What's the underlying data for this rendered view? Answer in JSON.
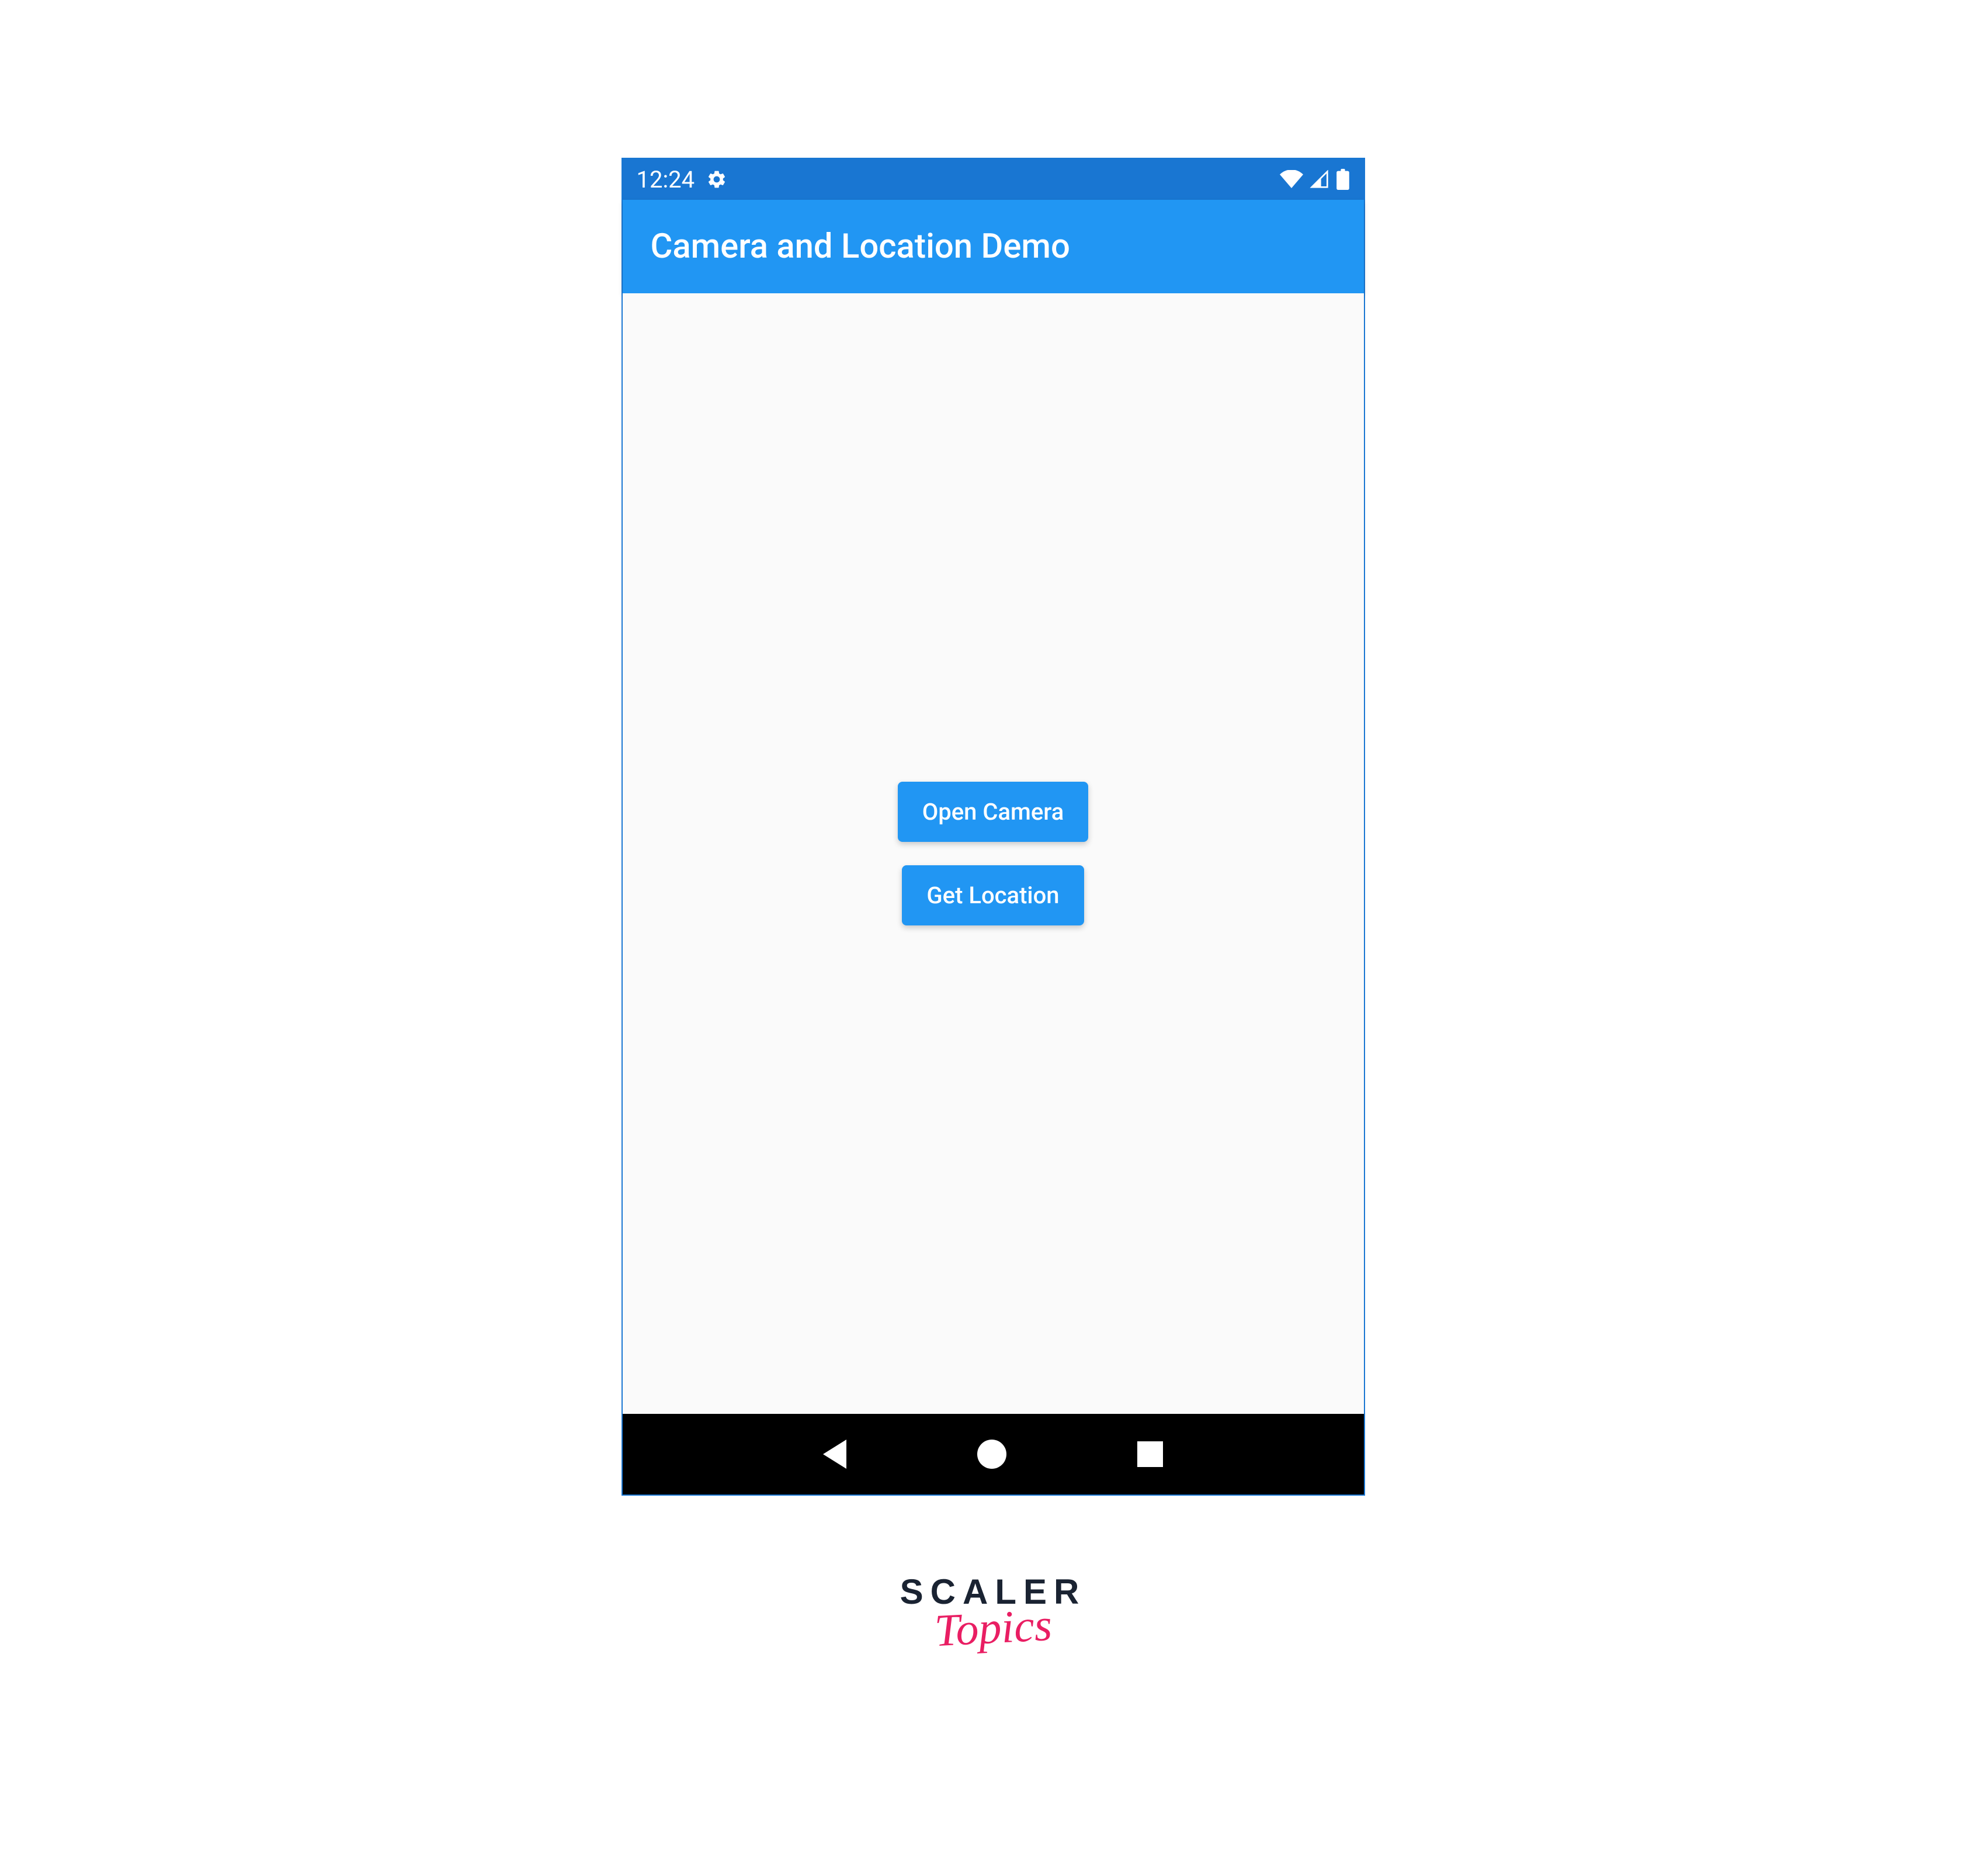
{
  "status_bar": {
    "time": "12:24"
  },
  "app_bar": {
    "title": "Camera and Location Demo"
  },
  "buttons": {
    "open_camera": "Open Camera",
    "get_location": "Get Location"
  },
  "watermark": {
    "line1": "SCALER",
    "line2": "Topics"
  }
}
